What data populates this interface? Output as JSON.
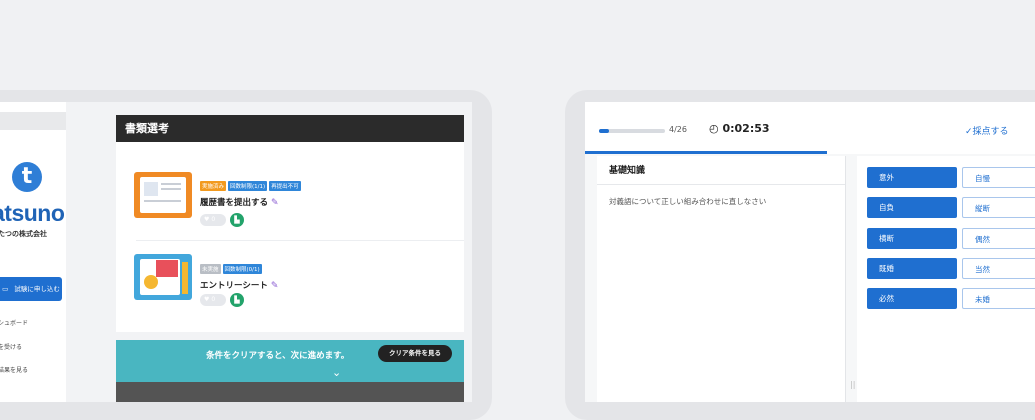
{
  "left": {
    "sidebar": {
      "logo_mark": "t",
      "logo_word": "atsuno",
      "logo_sub": "たつの株式会社",
      "apply_label": "試験に申し込む",
      "menu": [
        "ッシュボード",
        "験を受ける",
        "験結果を見る"
      ]
    },
    "panel_title": "書類選考",
    "docs": [
      {
        "tags": [
          {
            "text": "実施済み",
            "color": "orange"
          },
          {
            "text": "回数制限(1/1)",
            "color": "blue"
          },
          {
            "text": "再提出不可",
            "color": "blue"
          }
        ],
        "title": "履歴書を提出する",
        "likes": "0"
      },
      {
        "tags": [
          {
            "text": "未実施",
            "color": "gray"
          },
          {
            "text": "回数制限(0/1)",
            "color": "blue"
          }
        ],
        "title": "エントリーシート",
        "likes": "0"
      }
    ],
    "banner": {
      "text": "条件をクリアすると、次に進めます。",
      "button": "クリア条件を見る"
    }
  },
  "right": {
    "progress_text": "4/26",
    "progress_fraction": 0.15,
    "timer": "0:02:53",
    "score_label": "採点する",
    "question_title": "基礎知識",
    "question_text": "対義語について正しい組み合わせに直しなさい",
    "pairs": [
      {
        "left": "意外",
        "right": "自慢"
      },
      {
        "left": "自負",
        "right": "縦断"
      },
      {
        "left": "横断",
        "right": "偶然"
      },
      {
        "left": "既婚",
        "right": "当然"
      },
      {
        "left": "必然",
        "right": "未婚"
      }
    ]
  }
}
